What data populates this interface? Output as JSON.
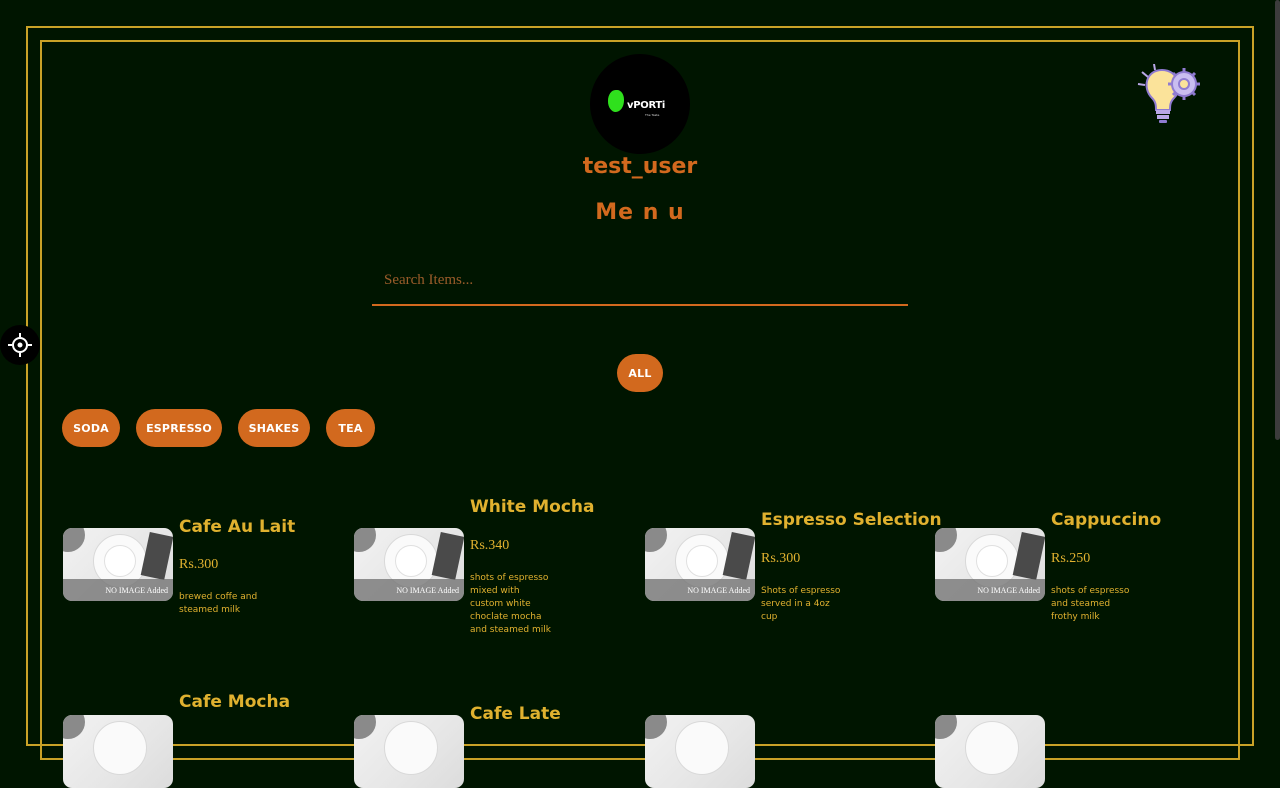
{
  "header": {
    "logo_text": "vPORTi",
    "logo_sub": "The Taste",
    "username": "test_user",
    "menu_title": "Me n u"
  },
  "search": {
    "placeholder": "Search Items...",
    "value": ""
  },
  "filters": {
    "all": "ALL",
    "categories": [
      "SODA",
      "ESPRESSO",
      "SHAKES",
      "TEA"
    ]
  },
  "image_caption": "NO IMAGE Added",
  "items": [
    {
      "name": "Cafe Au Lait",
      "price": "Rs.300",
      "desc": "brewed coffe and steamed milk"
    },
    {
      "name": "White Mocha",
      "price": "Rs.340",
      "desc": "shots of espresso mixed with custom white choclate mocha and steamed milk"
    },
    {
      "name": "Espresso Selection",
      "price": "Rs.300",
      "desc": "Shots of espresso served in a 4oz cup"
    },
    {
      "name": "Cappuccino",
      "price": "Rs.250",
      "desc": "shots of espresso and steamed frothy milk"
    },
    {
      "name": "Cafe Mocha",
      "price": "",
      "desc": ""
    },
    {
      "name": "Cafe Late",
      "price": "",
      "desc": ""
    }
  ],
  "colors": {
    "background": "#001500",
    "border": "#c9a227",
    "accent": "#d2691e",
    "text_gold": "#e0b12f"
  }
}
